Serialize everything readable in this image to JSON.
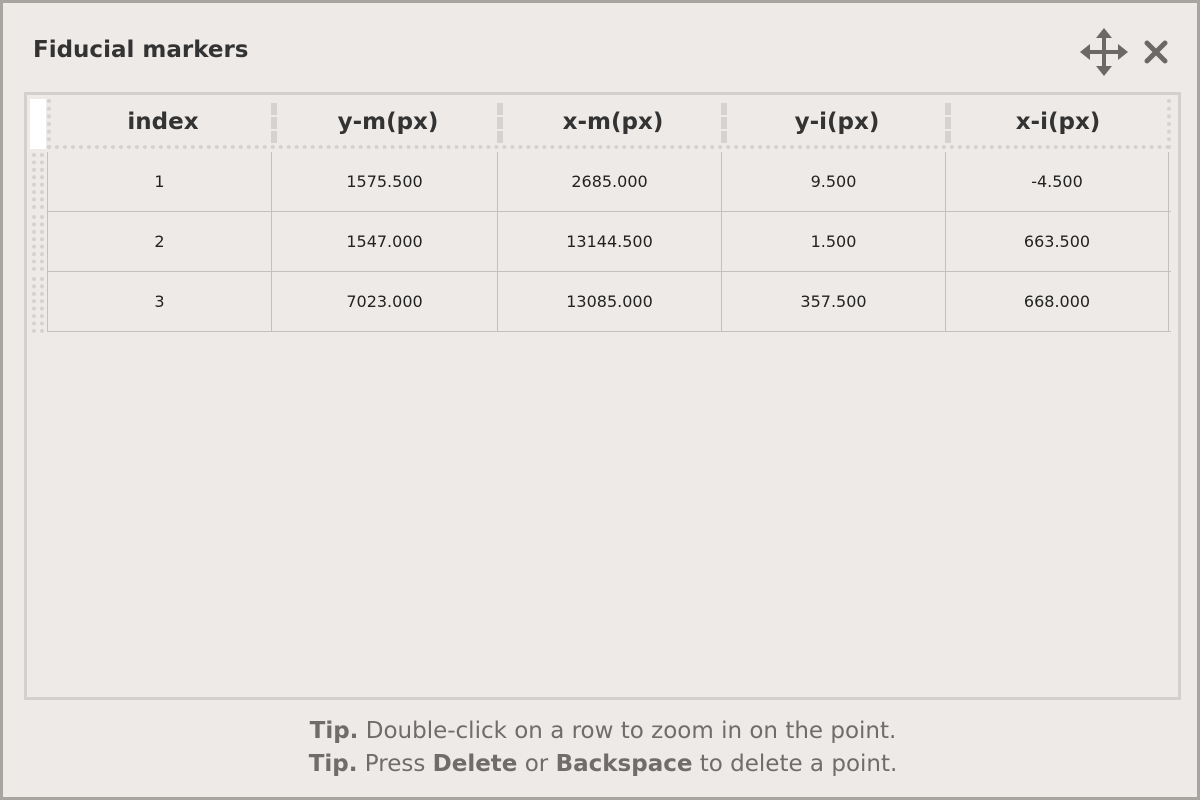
{
  "window": {
    "title": "Fiducial markers",
    "icons": {
      "move": "move-arrows-icon",
      "close": "close-x-icon"
    }
  },
  "table": {
    "columns": [
      "index",
      "y-m(px)",
      "x-m(px)",
      "y-i(px)",
      "x-i(px)"
    ],
    "rows": [
      [
        "1",
        "1575.500",
        "2685.000",
        "9.500",
        "-4.500"
      ],
      [
        "2",
        "1547.000",
        "13144.500",
        "1.500",
        "663.500"
      ],
      [
        "3",
        "7023.000",
        "13085.000",
        "357.500",
        "668.000"
      ]
    ]
  },
  "tips": [
    {
      "prefix": "Tip.",
      "text": " Double-click on a row to zoom in on the point."
    },
    {
      "prefix": "Tip.",
      "part1": " Press ",
      "key1": "Delete",
      "part2": " or ",
      "key2": "Backspace",
      "part3": " to delete a point."
    }
  ],
  "colors": {
    "background": "#eeeae7",
    "border": "#a8a4a0",
    "text": "#333333",
    "tip_text": "#6f6c69",
    "icon": "#6b6866"
  }
}
